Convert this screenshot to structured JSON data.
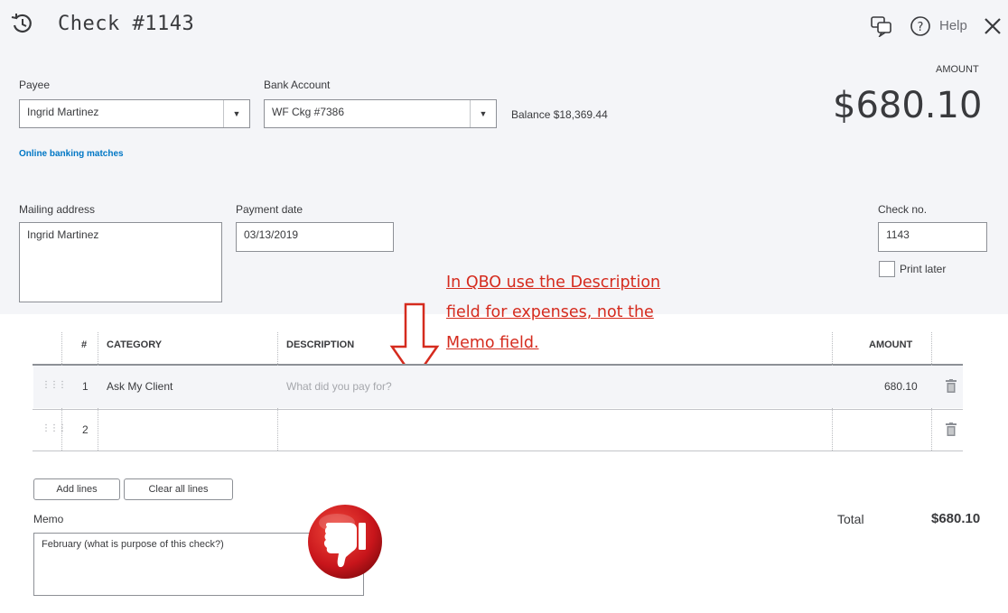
{
  "header": {
    "title": "Check #1143",
    "help_label": "Help"
  },
  "payee": {
    "label": "Payee",
    "value": "Ingrid Martinez",
    "online_banking_link": "Online banking matches"
  },
  "bank_account": {
    "label": "Bank Account",
    "value": "WF Ckg #7386",
    "balance_text": "Balance $18,369.44"
  },
  "amount": {
    "label": "AMOUNT",
    "value": "$680.10"
  },
  "mailing_address": {
    "label": "Mailing address",
    "value": "Ingrid Martinez"
  },
  "payment_date": {
    "label": "Payment date",
    "value": "03/13/2019"
  },
  "check_no": {
    "label": "Check no.",
    "value": "1143",
    "print_later_label": "Print later"
  },
  "annotation": {
    "line1": "In QBO use the Description",
    "line2": "field for expenses, not the",
    "line3": "Memo field. "
  },
  "table": {
    "headers": {
      "num": "#",
      "category": "CATEGORY",
      "description": "DESCRIPTION",
      "amount": "AMOUNT"
    },
    "rows": [
      {
        "num": "1",
        "category": "Ask My Client",
        "description_placeholder": "What did you pay for?",
        "amount": "680.10"
      },
      {
        "num": "2",
        "category": "",
        "description_placeholder": "",
        "amount": ""
      }
    ]
  },
  "buttons": {
    "add_lines": "Add lines",
    "clear_all_lines": "Clear all lines"
  },
  "memo": {
    "label": "Memo",
    "value": "February (what is purpose of this check?)"
  },
  "total": {
    "label": "Total",
    "value": "$680.10"
  },
  "colors": {
    "annotation_red": "#d52b1e",
    "thumbs_down_red": "#c8151b",
    "link_blue": "#0077c5"
  },
  "icons": [
    "recent-transactions-icon",
    "feedback-icon",
    "help-icon",
    "close-icon",
    "dropdown-arrow-icon",
    "drag-handle-icon",
    "trash-icon",
    "thumbs-down-icon",
    "down-arrow-icon"
  ]
}
